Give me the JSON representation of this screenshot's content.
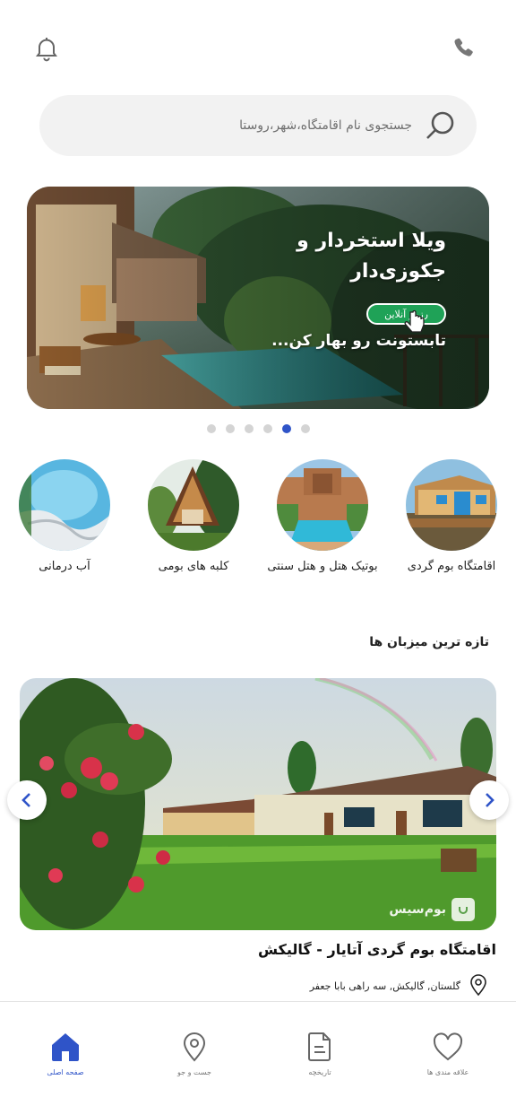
{
  "header": {
    "phone_icon": "phone-icon",
    "bell_icon": "bell-icon"
  },
  "search": {
    "placeholder": "جستجوی نام اقامتگاه،شهر،روستا",
    "icon": "search-icon"
  },
  "banner": {
    "title": "ویلا استخردار و جکوزی‌دار",
    "button_label": "رزرو آنلاین",
    "subtitle": "تابستونت رو بهار کن...",
    "pager": {
      "count": 6,
      "active_index": 4
    }
  },
  "categories": [
    {
      "label": "اقامتگاه بوم گردی"
    },
    {
      "label": "بوتیک هتل و هتل سنتی"
    },
    {
      "label": "کلبه های بومی"
    },
    {
      "label": "آب درمانی"
    }
  ],
  "section": {
    "title": "تازه ترین میزبان ها"
  },
  "host": {
    "name": "اقامتگاه بوم گردی آتایار - گالیکش",
    "location": "گلستان, گالیکش, سه راهی بابا جعفر",
    "watermark": "بوم‌سیس"
  },
  "bottom_nav": [
    {
      "label": "صفحه اصلی",
      "icon": "home-icon",
      "active": true
    },
    {
      "label": "جست و جو",
      "icon": "location-pin-icon",
      "active": false
    },
    {
      "label": "تاریخچه",
      "icon": "document-icon",
      "active": false
    },
    {
      "label": "علاقه مندی ها",
      "icon": "heart-icon",
      "active": false
    }
  ],
  "colors": {
    "accent": "#2f54c8",
    "banner_button": "#1fa257",
    "search_bg": "#f2f2f2"
  }
}
